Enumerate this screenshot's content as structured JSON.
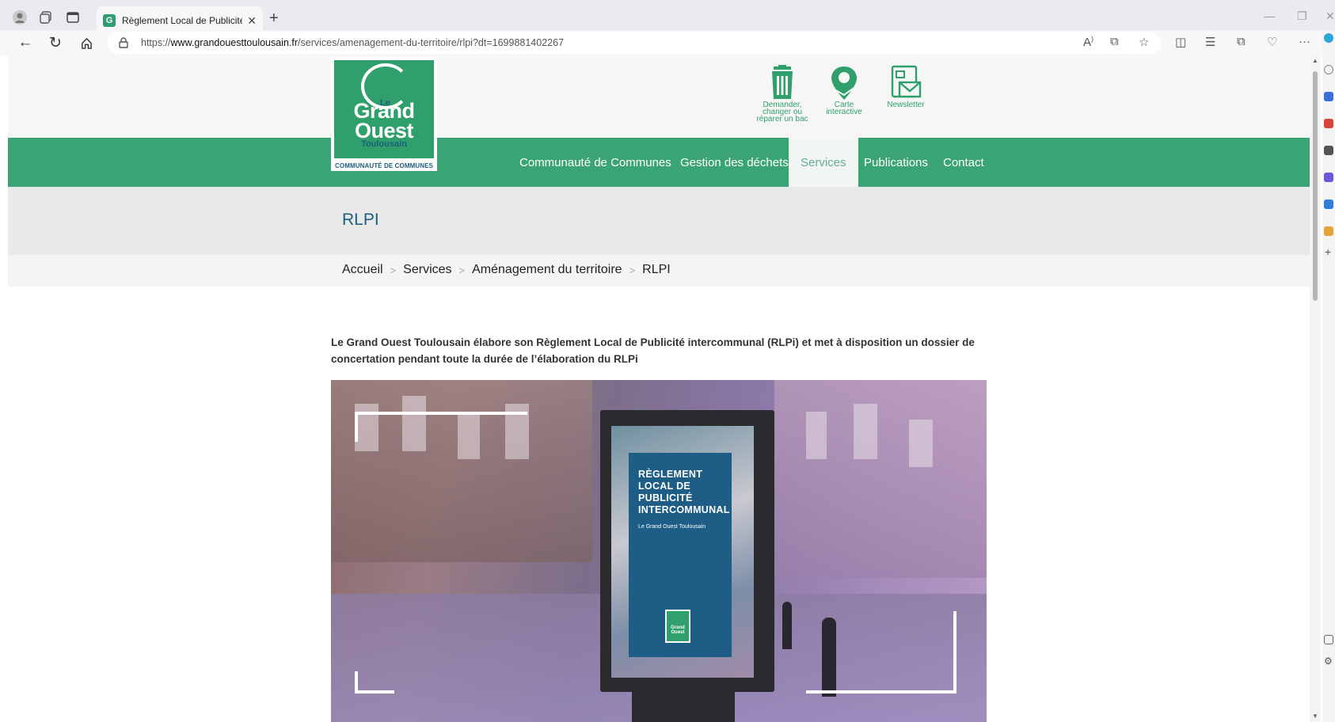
{
  "browser": {
    "tab_title": "Règlement Local de Publicité inte",
    "url_prefix": "https://",
    "url_domain": "www.grandouesttoulousain.fr",
    "url_path": "/services/amenagement-du-territoire/rlpi?dt=1699881402267"
  },
  "logo": {
    "le": "Le",
    "line1": "Grand",
    "line2": "Ouest",
    "line3": "Toulousain",
    "community": "COMMUNAUTÉ DE COMMUNES"
  },
  "quick_links": [
    {
      "label_lines": [
        "Demander,",
        "changer ou",
        "réparer un bac"
      ],
      "icon": "trash-bin-icon"
    },
    {
      "label_lines": [
        "Carte",
        "interactive"
      ],
      "icon": "map-pin-icon"
    },
    {
      "label_lines": [
        "Newsletter"
      ],
      "icon": "newsletter-icon"
    }
  ],
  "menu": [
    {
      "label": "Communauté de Communes",
      "active": false
    },
    {
      "label": "Gestion des déchets",
      "active": false
    },
    {
      "label": "Services",
      "active": true
    },
    {
      "label": "Publications",
      "active": false
    },
    {
      "label": "Contact",
      "active": false
    }
  ],
  "page": {
    "title": "RLPI",
    "breadcrumb": [
      "Accueil",
      "Services",
      "Aménagement du territoire",
      "RLPI"
    ],
    "intro_line1": "Le Grand Ouest Toulousain élabore son Règlement Local de Publicité intercommunal  (RLPi) et met à disposition un dossier de",
    "intro_line2": "concertation pendant toute la durée de l’élaboration du RLPi"
  },
  "hero": {
    "poster_lines": [
      "RÈGLEMENT",
      "LOCAL DE",
      "PUBLICITÉ",
      "INTERCOMMUNAL"
    ],
    "poster_sub": "Le Grand Ouest Toulousain",
    "poster_logo_line1": "Grand",
    "poster_logo_line2": "Ouest"
  },
  "colors": {
    "brand_green": "#3aa474",
    "brand_blue": "#1c5e7d"
  }
}
